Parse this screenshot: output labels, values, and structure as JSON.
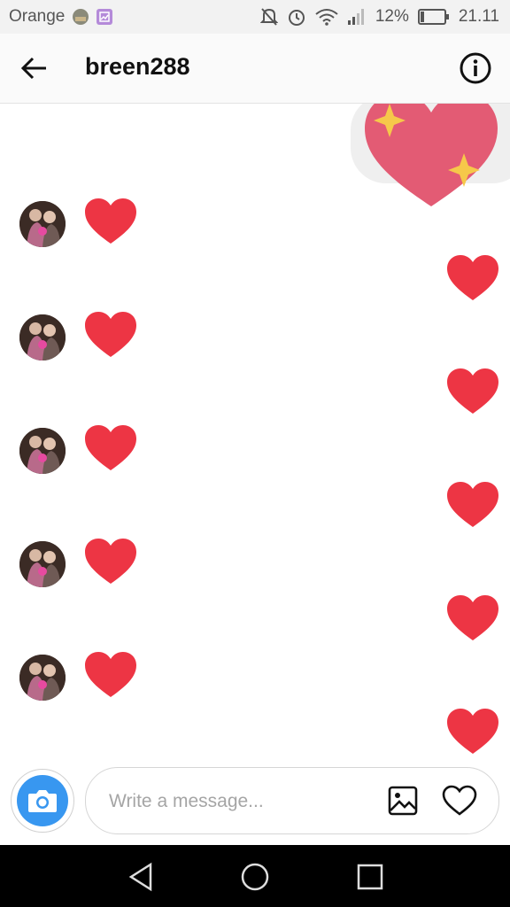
{
  "status_bar": {
    "carrier": "Orange",
    "battery_percent": "12%",
    "time": "21.11"
  },
  "header": {
    "title": "breen288",
    "back_icon": "arrow-left-icon",
    "info_icon": "info-circle-icon"
  },
  "chat": {
    "messages": [
      {
        "sender": "other",
        "content": "heart"
      },
      {
        "sender": "me",
        "content": "heart"
      },
      {
        "sender": "other",
        "content": "heart"
      },
      {
        "sender": "me",
        "content": "heart"
      },
      {
        "sender": "other",
        "content": "heart"
      },
      {
        "sender": "me",
        "content": "heart"
      },
      {
        "sender": "other",
        "content": "heart"
      },
      {
        "sender": "me",
        "content": "heart"
      },
      {
        "sender": "other",
        "content": "heart"
      },
      {
        "sender": "me",
        "content": "heart"
      }
    ],
    "heart_color": "#ed3544",
    "sparkle_heart_color": "#e35b74"
  },
  "composer": {
    "placeholder": "Write a message...",
    "camera_icon": "camera-icon",
    "gallery_icon": "image-icon",
    "like_icon": "heart-outline-icon",
    "accent": "#3897f0"
  },
  "navbar": {
    "back_icon": "triangle-back-icon",
    "home_icon": "circle-home-icon",
    "recent_icon": "square-recents-icon"
  }
}
